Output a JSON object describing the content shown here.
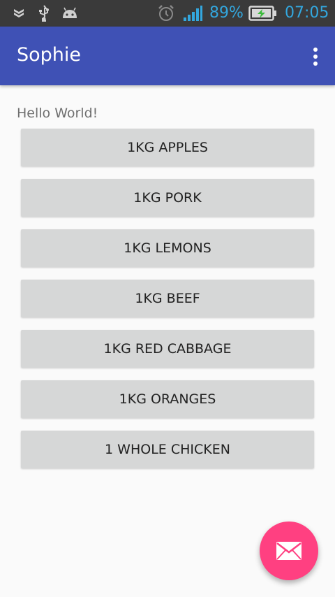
{
  "status_bar": {
    "battery_percent": "89%",
    "time": "07:05",
    "icons": [
      "notification-shield-icon",
      "usb-icon",
      "android-debug-icon",
      "alarm-icon",
      "signal-icon",
      "battery-charging-icon"
    ],
    "accent_color": "#33a7de"
  },
  "app_bar": {
    "title": "Sophie",
    "overflow_icon": "more-vert-icon",
    "background_color": "#3f51b5"
  },
  "content": {
    "hello_text": "Hello World!",
    "buttons": [
      "1KG APPLES",
      "1KG PORK",
      "1KG LEMONS",
      "1KG BEEF",
      "1KG RED CABBAGE",
      "1KG ORANGES",
      "1 WHOLE CHICKEN"
    ]
  },
  "fab": {
    "icon": "mail-icon",
    "color": "#ff4081"
  }
}
